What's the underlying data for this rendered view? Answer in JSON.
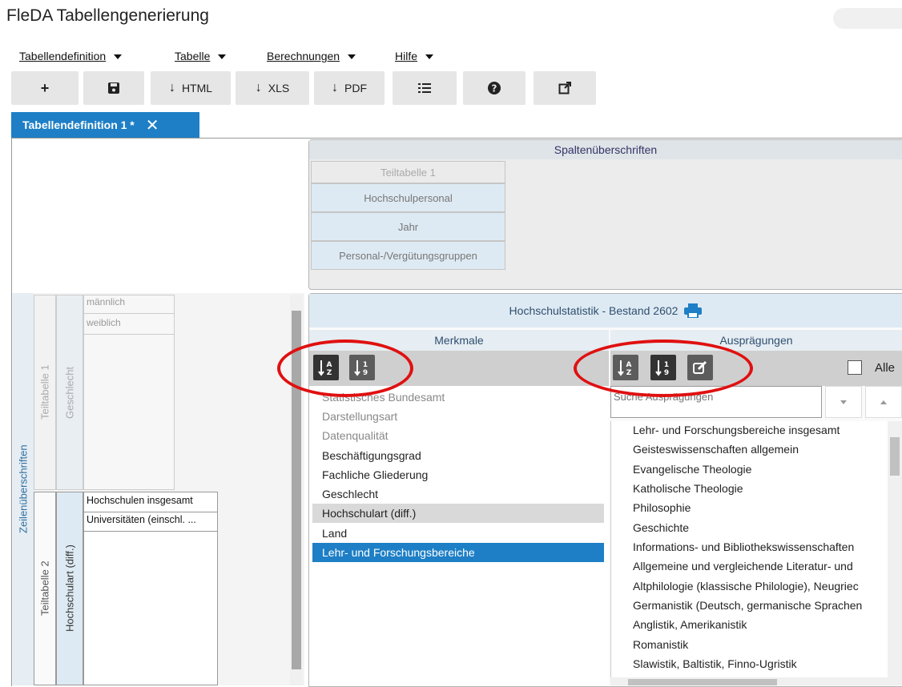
{
  "app": {
    "title": "FleDA Tabellengenerierung"
  },
  "menu": [
    {
      "label": "Tabellendefinition"
    },
    {
      "label": "Tabelle"
    },
    {
      "label": "Berechnungen"
    },
    {
      "label": "Hilfe"
    }
  ],
  "toolbar": {
    "new": "+",
    "html": "HTML",
    "xls": "XLS",
    "pdf": "PDF"
  },
  "tab": {
    "label": "Tabellendefinition 1 *",
    "close": "✕"
  },
  "column_headers": {
    "title": "Spaltenüberschriften",
    "cells": [
      "Teiltabelle 1",
      "Hochschulpersonal",
      "Jahr",
      "Personal-/Vergütungsgruppen"
    ]
  },
  "row_headers": {
    "title": "Zeilenüberschriften",
    "group1": {
      "label": "Teiltabelle 1",
      "var": "Geschlecht",
      "values": [
        "männlich",
        "weiblich"
      ]
    },
    "group2": {
      "label": "Teiltabelle 2",
      "var": "Hochschulart (diff.)",
      "values": [
        "Hochschulen insgesamt",
        "Universitäten (einschl. ..."
      ]
    }
  },
  "stats": {
    "title": "Hochschulstatistik - Bestand 2602",
    "merkmale_header": "Merkmale",
    "auspraegungen_header": "Ausprägungen",
    "alle_label": "Alle",
    "search_placeholder": "Suche Ausprägungen",
    "merkmale": [
      "Statistisches Bundesamt",
      "Darstellungsart",
      "Datenqualität",
      "Beschäftigungsgrad",
      "Fachliche Gliederung",
      "Geschlecht",
      "Hochschulart (diff.)",
      "Land",
      "Lehr- und Forschungsbereiche"
    ],
    "auspraegungen": [
      "Lehr- und Forschungsbereiche insgesamt",
      "Geisteswissenschaften allgemein",
      "Evangelische Theologie",
      "Katholische Theologie",
      "Philosophie",
      "Geschichte",
      "Informations- und Bibliothekswissenschaften",
      "Allgemeine und vergleichende Literatur- und",
      "Altphilologie (klassische Philologie), Neugriec",
      "Germanistik (Deutsch, germanische Sprachen",
      "Anglistik, Amerikanistik",
      "Romanistik",
      "Slawistik, Baltistik, Finno-Ugristik"
    ]
  },
  "colors": {
    "accent": "#1e7fc6",
    "highlight_red": "#e01010",
    "selected_row": "#1e7fc6",
    "hover_row": "#d9d9d9"
  }
}
